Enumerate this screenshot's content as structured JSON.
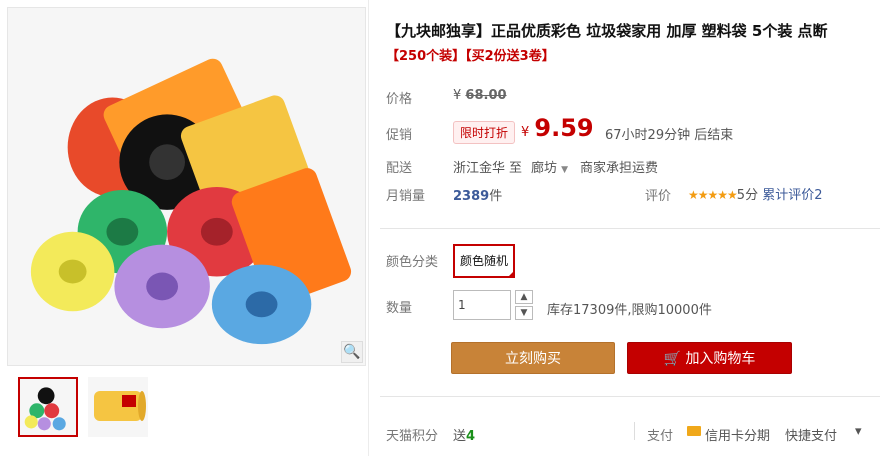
{
  "product": {
    "title": "【九块邮独享】正品优质彩色 垃圾袋家用 加厚 塑料袋 5个装 点断",
    "subtitle": "【250个装】【买2份送3卷】"
  },
  "price": {
    "label": "价格",
    "original": "68.00",
    "currency": "¥"
  },
  "promo": {
    "label": "促销",
    "badge": "限时打折",
    "currency": "¥",
    "price": "9.59",
    "countdown": "67小时29分钟 后结束"
  },
  "shipping": {
    "label": "配送",
    "from": "浙江金华",
    "to_word": "至",
    "to": "廊坊",
    "fee": "商家承担运费"
  },
  "sales": {
    "label": "月销量",
    "count": "2389",
    "unit": "件",
    "rating_label": "评价",
    "stars": "★★★★★",
    "score": "5分",
    "reviews": "累计评价2"
  },
  "options": {
    "color_label": "颜色分类",
    "color_value": "颜色随机",
    "qty_label": "数量",
    "qty_value": "1",
    "up": "▲",
    "down": "▼",
    "stock": "库存17309件,限购10000件"
  },
  "actions": {
    "buy": "立刻购买",
    "cart": "加入购物车"
  },
  "footer": {
    "points_label": "天猫积分",
    "points_prefix": "送",
    "points_value": "4",
    "pay_label": "支付",
    "credit": "信用卡分期",
    "quick": "快捷支付",
    "more": "▾"
  },
  "icons": {
    "zoom": "🔍",
    "cart": "🛒"
  },
  "colors": {
    "accent": "#c40000",
    "buy": "#c88338"
  }
}
